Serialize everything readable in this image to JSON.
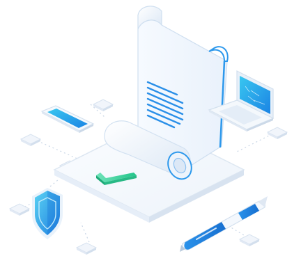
{
  "illustration": {
    "subject": "contract-signing",
    "icons": [
      "scroll-document-icon",
      "checkmark-icon",
      "smartphone-icon",
      "laptop-icon",
      "security-shield-icon",
      "pen-icon"
    ],
    "colors": {
      "accent_blue": "#1f8fe8",
      "accent_cyan": "#3fc6ee",
      "check_green": "#37d39b",
      "surface": "#f2f6fb",
      "outline": "#dfe8f3"
    }
  }
}
